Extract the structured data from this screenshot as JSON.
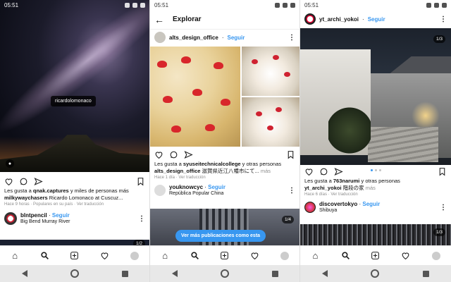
{
  "time": "05:51",
  "phone1": {
    "photo_tag": "ricardolomonaco",
    "likes_line_prefix": "Les gusta a ",
    "likes_user": "qnak.captures",
    "likes_line_suffix": " y miles de personas más",
    "caption_user": "milkywaychasers",
    "caption_text": " Ricardo Lomonaco at Cuscuz...",
    "meta": "Hace 9 horas · Populares en su país · Ver traducción",
    "next_user": "blntpencil",
    "next_follow": "Seguir",
    "next_location": "Big Bend Murray River",
    "next_badge": "1/2"
  },
  "phone2": {
    "header_title": "Explorar",
    "post_user": "alts_design_office",
    "post_follow": "Seguir",
    "likes_line_prefix": "Les gusta a ",
    "likes_user": "syuseitechnicalcollege",
    "likes_line_suffix": " y otras personas",
    "caption_user": "alts_design_office",
    "caption_text": " 滋賀県近江八幡市にて...",
    "caption_more": "más",
    "meta": "Hace 1 día · Ver traducción",
    "next_user": "youknowcyc",
    "next_follow": "Seguir",
    "next_location": "República Popular China",
    "more_button": "Ver más publicaciones como esta",
    "next_badge": "1/4"
  },
  "phone3": {
    "post_user": "yt_archi_yokoi",
    "post_follow": "Seguir",
    "image_badge": "1/3",
    "likes_line_prefix": "Les gusta a ",
    "likes_user": "763narumi",
    "likes_line_suffix": " y otras personas",
    "caption_user": "yt_archi_yokoi",
    "caption_text": " 階段の家",
    "caption_more": "más",
    "meta": "Hace 6 días · Ver traducción",
    "next_user": "discovertokyo",
    "next_follow": "Seguir",
    "next_location": "Shibuya",
    "next_badge": "1/3"
  },
  "icons": {
    "home": "home-icon",
    "search": "search-icon",
    "add": "add-icon",
    "heart": "heart-icon",
    "profile": "profile-icon"
  },
  "colors": {
    "accent": "#3897f0",
    "sysbar": "#e8e8e8"
  }
}
